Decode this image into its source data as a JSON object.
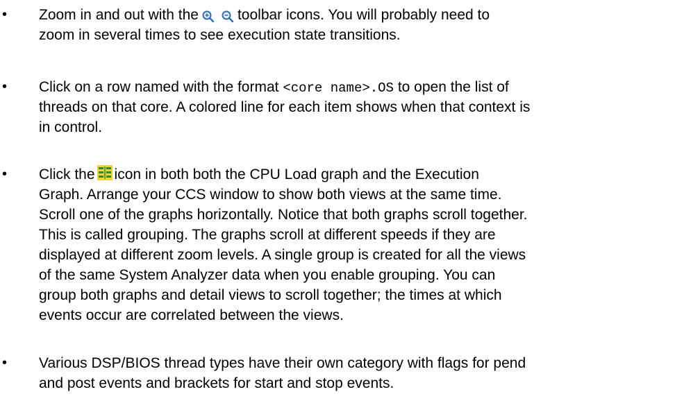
{
  "bullets": {
    "zoom": {
      "prefix": "Zoom in and out with the",
      "suffix": "toolbar icons. You will probably need to",
      "line2": "zoom in several times to see execution state transitions."
    },
    "threads": {
      "l1_prefix": "Click on a row named with the format",
      "l1_code": "<core name>.OS",
      "l1_suffix": "to open the list of",
      "l2": "threads on that core. A colored line for each item shows when that context is",
      "l3": "in control."
    },
    "grouping": {
      "l1_prefix": "Click the",
      "l1_suffix": "icon in both both the CPU Load graph and the Execution",
      "l2": "Graph. Arrange your CCS window to show both views at the same time.",
      "l3": "Scroll one of the graphs horizontally. Notice that both graphs scroll together.",
      "l4": "This is called grouping. The graphs scroll at different speeds if they are",
      "l5": "displayed at different zoom levels. A single group is created for all the views",
      "l6": "of the same System Analyzer data when you enable grouping. You can",
      "l7": "group both graphs and detail views to scroll together; the times at which",
      "l8": "events occur are correlated between the views."
    },
    "bios": {
      "l1": "Various DSP/BIOS thread types have their own category with flags for pend",
      "l2": "and post events and brackets for start and stop events."
    }
  },
  "icons": {
    "zoom_in": "zoom-in-icon",
    "zoom_out": "zoom-out-icon",
    "group": "group-graphs-icon"
  },
  "colors": {
    "text": "#000000",
    "icon_blue": "#2f6fb7",
    "icon_green": "#2e8b2e",
    "icon_yellow": "#f2d43a"
  }
}
